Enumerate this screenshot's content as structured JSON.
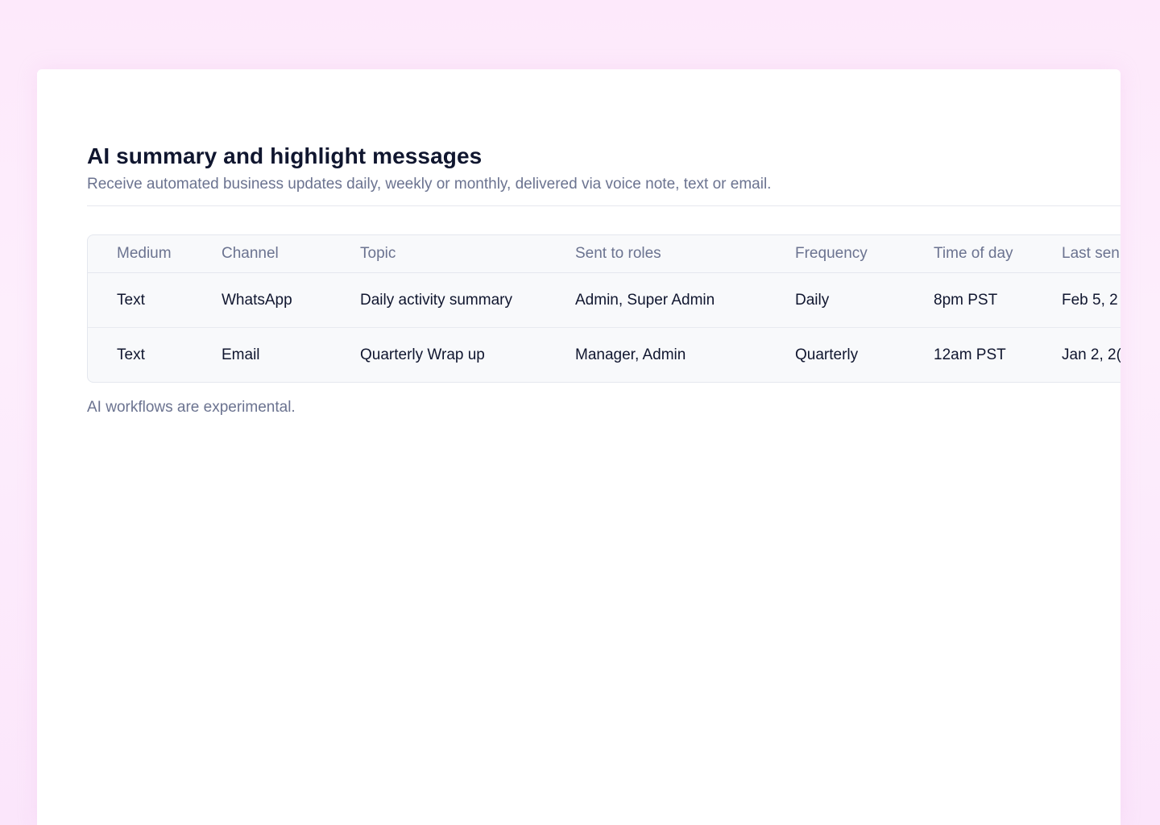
{
  "page": {
    "title": "AI summary and highlight messages",
    "subtitle": "Receive automated business updates daily, weekly or monthly, delivered via voice note, text or email.",
    "footnote": "AI workflows are experimental."
  },
  "table": {
    "headers": [
      "Medium",
      "Channel",
      "Topic",
      "Sent to roles",
      "Frequency",
      "Time of day",
      "Last sen"
    ],
    "rows": [
      [
        "Text",
        "WhatsApp",
        "Daily activity summary",
        "Admin, Super Admin",
        "Daily",
        "8pm PST",
        "Feb 5, 2"
      ],
      [
        "Text",
        "Email",
        "Quarterly Wrap up",
        "Manager, Admin",
        "Quarterly",
        "12am PST",
        "Jan 2, 2("
      ]
    ]
  },
  "colors": {
    "background": "#fde9fb",
    "panel": "#ffffff",
    "title": "#10162f",
    "muted": "#6b7390",
    "table_bg": "#f8f9fb",
    "border": "#e4e7ee"
  }
}
